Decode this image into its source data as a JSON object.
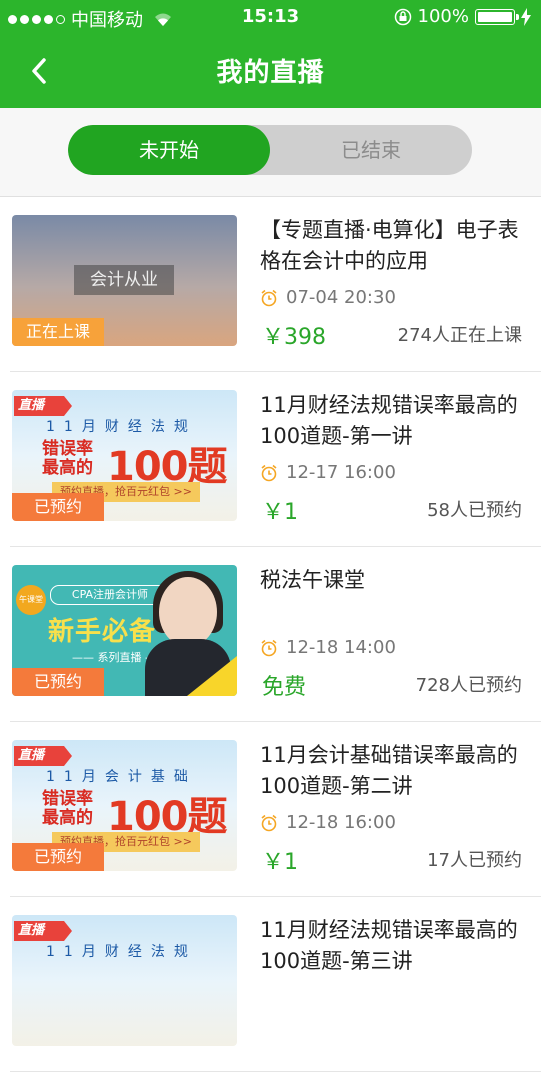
{
  "status_bar": {
    "carrier": "中国移动",
    "time": "15:13",
    "battery": "100%"
  },
  "nav": {
    "title": "我的直播"
  },
  "tabs": [
    {
      "label": "未开始"
    },
    {
      "label": "已结束"
    }
  ],
  "items": [
    {
      "title": "【专题直播·电算化】电子表格在会计中的应用",
      "time": "07-04  20:30",
      "price": "￥398",
      "count": "274人正在上课",
      "badge": "正在上课",
      "thumb_caption": "会计从业"
    },
    {
      "title": "11月财经法规错误率最高的100道题-第一讲",
      "time": "12-17  16:00",
      "price": "￥1",
      "count": "58人已预约",
      "badge": "已预约",
      "poster": {
        "tag": "直播",
        "sub": "11月财经法规",
        "red1": "错误率",
        "red2": "最高的",
        "big": "100题",
        "strip": "预约直播，抢百元红包 >>"
      }
    },
    {
      "title": "税法午课堂",
      "time": "12-18  14:00",
      "price": "免费",
      "count": "728人已预约",
      "badge": "已预约",
      "poster": {
        "stamp": "午课堂",
        "pill": "CPA注册会计师",
        "title": "新手必备",
        "sub": "—— 系列直播 ——"
      }
    },
    {
      "title": "11月会计基础错误率最高的100道题-第二讲",
      "time": "12-18  16:00",
      "price": "￥1",
      "count": "17人已预约",
      "badge": "已预约",
      "poster": {
        "tag": "直播",
        "sub": "11月会计基础",
        "red1": "错误率",
        "red2": "最高的",
        "big": "100题",
        "strip": "预约直播，抢百元红包 >>"
      }
    },
    {
      "title": "11月财经法规错误率最高的100道题-第三讲",
      "poster": {
        "tag": "直播",
        "sub": "11月财经法规"
      }
    }
  ]
}
